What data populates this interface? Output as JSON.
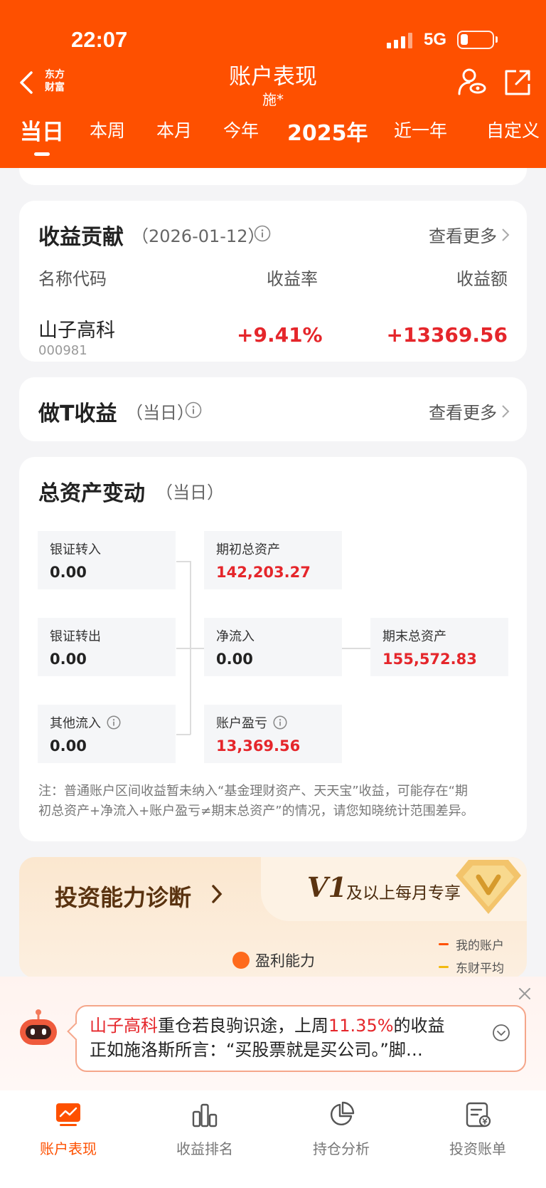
{
  "status_bar": {
    "time": "22:07",
    "network": "5G"
  },
  "header": {
    "brand_logo_line1": "东方",
    "brand_logo_line2": "财富",
    "title": "账户表现",
    "subtitle": "施*",
    "tabs": [
      "当日",
      "本周",
      "本月",
      "今年",
      "2025年",
      "近一年",
      "自定义"
    ],
    "active_tab": "当日"
  },
  "contribution": {
    "title": "收益贡献",
    "date": "（2026-01-12）",
    "more": "查看更多",
    "col_name": "名称代码",
    "col_rate": "收益率",
    "col_amount": "收益额",
    "rows": [
      {
        "name": "山子高科",
        "code": "000981",
        "rate": "+9.41%",
        "amount": "+13369.56"
      }
    ]
  },
  "t_trading": {
    "title": "做T收益",
    "period": "（当日）",
    "more": "查看更多"
  },
  "asset_change": {
    "title": "总资产变动",
    "period": "（当日）",
    "bank_in_label": "银证转入",
    "bank_in_value": "0.00",
    "bank_out_label": "银证转出",
    "bank_out_value": "0.00",
    "other_in_label": "其他流入",
    "other_in_value": "0.00",
    "start_label": "期初总资产",
    "start_value": "142,203.27",
    "net_in_label": "净流入",
    "net_in_value": "0.00",
    "pnl_label": "账户盈亏",
    "pnl_value": "13,369.56",
    "end_label": "期末总资产",
    "end_value": "155,572.83",
    "note_line1": "注：普通账户区间收益暂未纳入“基金理财资产、天天宝”收益，可能存在“期",
    "note_line2": "初总资产+净流入+账户盈亏≠期末总资产”的情况，请您知晓统计范围差异。"
  },
  "promo": {
    "title": "投资能力诊断",
    "level": "V1",
    "level_text": "及以上每月专享",
    "legend_mine": "我的账户",
    "legend_avg": "东财平均",
    "metric": "盈利能力",
    "colors": {
      "mine": "#fe5000",
      "avg": "#f2b90f"
    }
  },
  "ai_tip": {
    "line1_hl1": "山子高科",
    "line1_t1": "重仓若良驹识途，上周",
    "line1_hl2": "11.35%",
    "line1_t2": "的收益",
    "line2": "正如施洛斯所言：“买股票就是买公司。”脚…"
  },
  "bottom_nav": {
    "items": [
      "账户表现",
      "收益排名",
      "持仓分析",
      "投资账单"
    ],
    "active": "账户表现"
  },
  "colors": {
    "brand": "#fe5000",
    "up": "#e5262b"
  }
}
